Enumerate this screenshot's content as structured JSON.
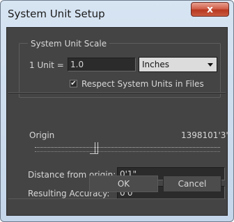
{
  "window": {
    "title": "System Unit Setup",
    "close_label": "x"
  },
  "system_unit_scale": {
    "group_title": "System Unit Scale",
    "unit_label": "1 Unit =",
    "unit_value": "1.0",
    "unit_type_selected": "Inches",
    "respect_checkbox_checked": true,
    "respect_checkbox_label": "Respect System Units in Files"
  },
  "origin": {
    "label": "Origin",
    "readout": "1398101'3\"",
    "slider_position_fraction": 0.33
  },
  "distance": {
    "label": "Distance from origin:",
    "value": "0'1\""
  },
  "accuracy": {
    "label": "Resulting Accuracy:",
    "value": "0'0\""
  },
  "buttons": {
    "ok_label": "OK",
    "cancel_label": "Cancel"
  },
  "colors": {
    "panel_bg": "#444444",
    "title_bar": "#c9daec",
    "close_red": "#c94a34"
  }
}
